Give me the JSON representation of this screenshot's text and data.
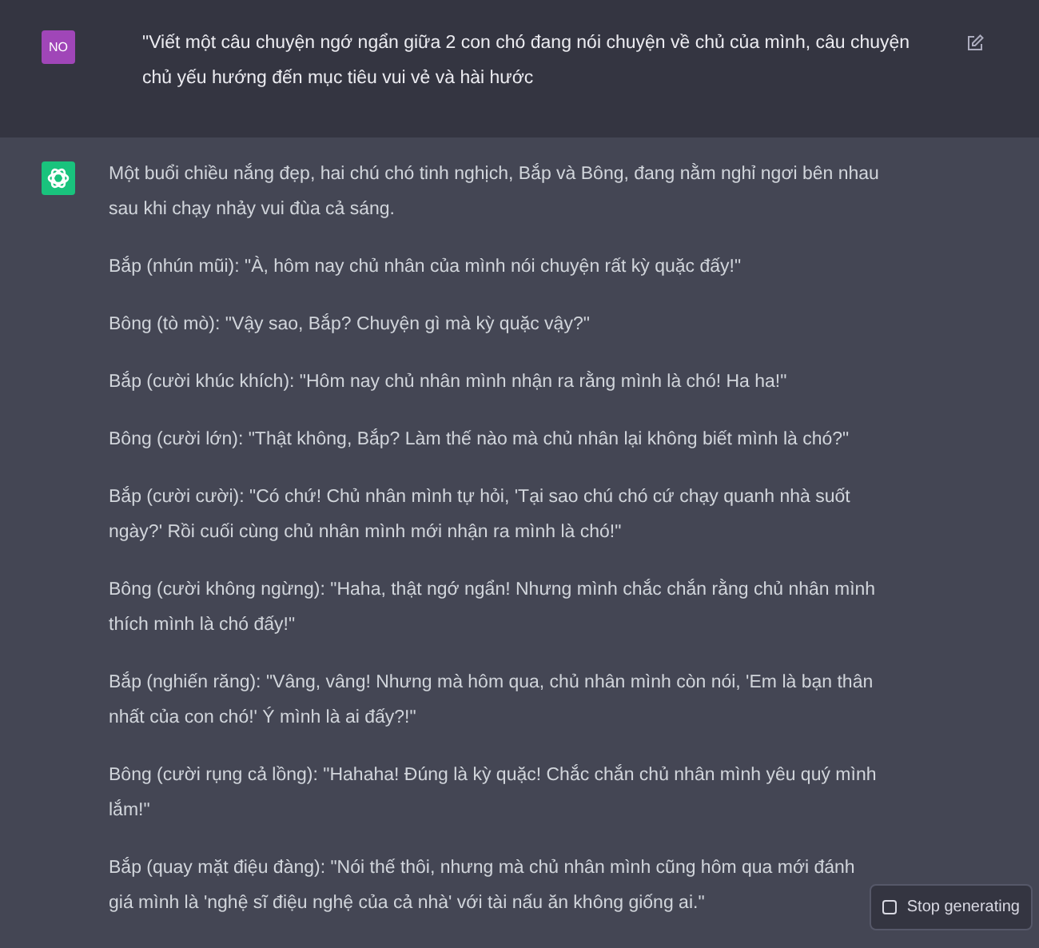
{
  "user_message": {
    "avatar": "NO",
    "text": "\"Viết một câu chuyện ngớ ngẩn giữa 2 con chó đang nói chuyện về chủ của mình, câu chuyện chủ yếu hướng đến mục tiêu vui vẻ và hài hước"
  },
  "assistant_message": {
    "paragraphs": [
      "Một buổi chiều nắng đẹp, hai chú chó tinh nghịch, Bắp và Bông, đang nằm nghỉ ngơi bên nhau sau khi chạy nhảy vui đùa cả sáng.",
      "Bắp (nhún mũi): \"À, hôm nay chủ nhân của mình nói chuyện rất kỳ quặc đấy!\"",
      "Bông (tò mò): \"Vậy sao, Bắp? Chuyện gì mà kỳ quặc vậy?\"",
      "Bắp (cười khúc khích): \"Hôm nay chủ nhân mình nhận ra rằng mình là chó! Ha ha!\"",
      "Bông (cười lớn): \"Thật không, Bắp? Làm thế nào mà chủ nhân lại không biết mình là chó?\"",
      "Bắp (cười cười): \"Có chứ! Chủ nhân mình tự hỏi, 'Tại sao chú chó cứ chạy quanh nhà suốt ngày?' Rồi cuối cùng chủ nhân mình mới nhận ra mình là chó!\"",
      "Bông (cười không ngừng): \"Haha, thật ngớ ngẩn! Nhưng mình chắc chắn rằng chủ nhân mình thích mình là chó đấy!\"",
      "Bắp (nghiến răng): \"Vâng, vâng! Nhưng mà hôm qua, chủ nhân mình còn nói, 'Em là bạn thân nhất của con chó!' Ý mình là ai đấy?!\"",
      "Bông (cười rụng cả lồng): \"Hahaha! Đúng là kỳ quặc! Chắc chắn chủ nhân mình yêu quý mình lắm!\"",
      "Bắp (quay mặt điệu đàng): \"Nói thế thôi, nhưng mà chủ nhân mình cũng hôm qua mới đánh giá mình là 'nghệ sĩ điệu nghệ của cả nhà' với tài nấu ăn không giống ai.\""
    ]
  },
  "stop_button": {
    "label": "Stop generating"
  }
}
